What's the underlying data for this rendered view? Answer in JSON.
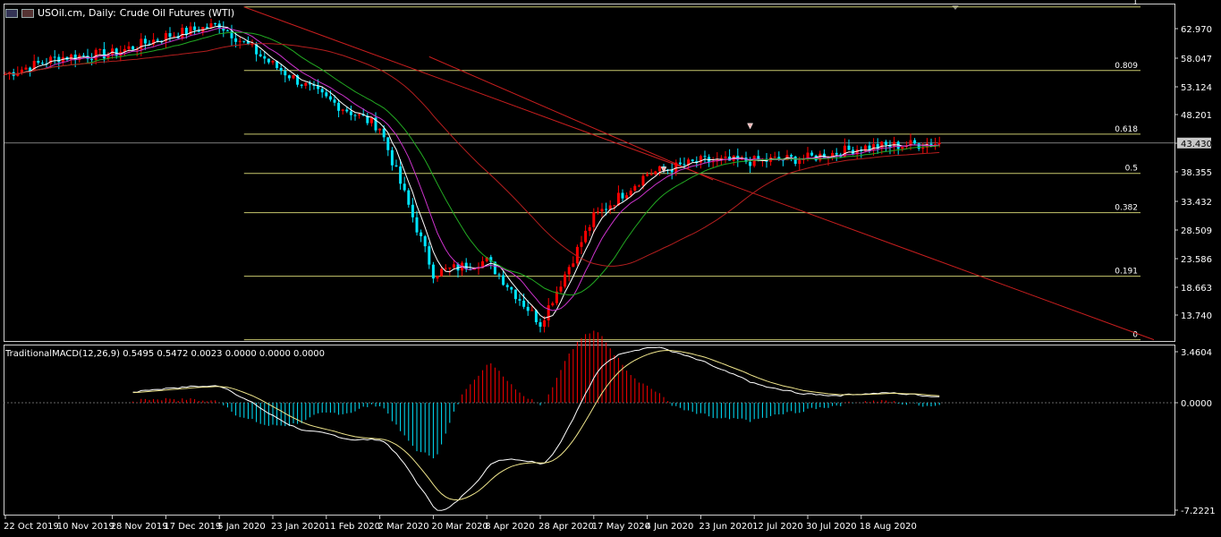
{
  "header": {
    "symbol": "USOil.cm, Daily:",
    "description": "Crude Oil Futures (WTI)"
  },
  "price_axis": {
    "ticks": [
      "62.970",
      "58.047",
      "53.124",
      "48.201",
      "43.278",
      "38.355",
      "33.432",
      "28.509",
      "23.586",
      "18.663",
      "13.740"
    ],
    "current": "43.430"
  },
  "fibonacci": {
    "levels": [
      "1",
      "0.809",
      "0.618",
      "0.5",
      "0.382",
      "0.191",
      "0"
    ]
  },
  "macd": {
    "label": "TraditionalMACD(12,26,9) 0.5495 0.5472 0.0023 0.0000 0.0000 0.0000",
    "ticks": [
      "3.4604",
      "0.0000",
      "-7.2221"
    ]
  },
  "time_axis": {
    "labels": [
      "22 Oct 2019",
      "10 Nov 2019",
      "28 Nov 2019",
      "17 Dec 2019",
      "5 Jan 2020",
      "23 Jan 2020",
      "11 Feb 2020",
      "2 Mar 2020",
      "20 Mar 2020",
      "8 Apr 2020",
      "28 Apr 2020",
      "17 May 2020",
      "4 Jun 2020",
      "23 Jun 2020",
      "12 Jul 2020",
      "30 Jul 2020",
      "18 Aug 2020"
    ]
  },
  "colors": {
    "background": "#000000",
    "bull": "#ff0000",
    "bear": "#00e5ff",
    "fib": "#c8c86e",
    "trendline": "#c81e1e",
    "ma_fast": "#ffffff",
    "ma_mid": "#cc33cc",
    "ma_slow": "#22aa22",
    "ma_long": "#b41e1e",
    "macd_line": "#ffffff",
    "signal_line": "#f0e68c"
  },
  "chart_data": {
    "type": "candlestick",
    "title": "USOil.cm, Daily: Crude Oil Futures (WTI)",
    "key_points": {
      "dates": [
        "22 Oct 2019",
        "10 Nov 2019",
        "28 Nov 2019",
        "17 Dec 2019",
        "5 Jan 2020",
        "23 Jan 2020",
        "11 Feb 2020",
        "2 Mar 2020",
        "20 Mar 2020",
        "8 Apr 2020",
        "28 Apr 2020",
        "17 May 2020",
        "4 Jun 2020",
        "23 Jun 2020",
        "12 Jul 2020",
        "30 Jul 2020",
        "18 Aug 2020"
      ],
      "close": [
        54.5,
        57.2,
        57.8,
        60.6,
        62.5,
        56.0,
        50.5,
        46.0,
        22.5,
        24.5,
        14.5,
        31.5,
        38.5,
        40.5,
        40.5,
        41.0,
        42.7
      ]
    },
    "price_ylim": [
      11.6,
      65.7
    ],
    "last_price": 43.43,
    "fib_levels": [
      1,
      0.809,
      0.618,
      0.5,
      0.382,
      0.191,
      0
    ],
    "macd_ylim": [
      -7.2221,
      3.4604
    ]
  }
}
